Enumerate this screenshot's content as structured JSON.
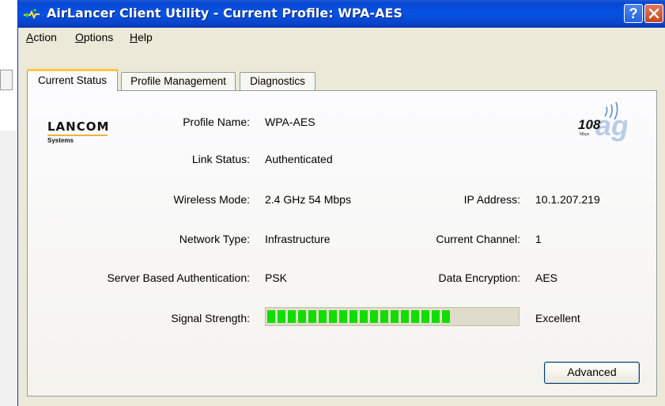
{
  "window": {
    "title": "AirLancer Client Utility - Current Profile: WPA-AES",
    "help_label": "?"
  },
  "menu": {
    "items": [
      {
        "label": "Action",
        "mnemonic": "A"
      },
      {
        "label": "Options",
        "mnemonic": "O"
      },
      {
        "label": "Help",
        "mnemonic": "H"
      }
    ]
  },
  "tabs": [
    {
      "label": "Current Status",
      "active": true
    },
    {
      "label": "Profile Management",
      "active": false
    },
    {
      "label": "Diagnostics",
      "active": false
    }
  ],
  "logo": {
    "name": "LANCOM",
    "sub": "Systems"
  },
  "badge": {
    "speed": "108",
    "unit": "Mbps",
    "band": "ag"
  },
  "status": {
    "profile_name_label": "Profile Name:",
    "profile_name": "WPA-AES",
    "link_status_label": "Link Status:",
    "link_status": "Authenticated",
    "wireless_mode_label": "Wireless Mode:",
    "wireless_mode": "2.4 GHz 54 Mbps",
    "ip_address_label": "IP Address:",
    "ip_address": "10.1.207.219",
    "network_type_label": "Network Type:",
    "network_type": "Infrastructure",
    "current_channel_label": "Current Channel:",
    "current_channel": "1",
    "server_auth_label": "Server Based Authentication:",
    "server_auth": "PSK",
    "data_encryption_label": "Data Encryption:",
    "data_encryption": "AES",
    "signal_strength_label": "Signal Strength:",
    "signal_strength": "Excellent",
    "signal_level": 0.86,
    "signal_segments": 18
  },
  "buttons": {
    "advanced": "Advanced"
  },
  "colors": {
    "titlebar": "#0553e4",
    "signal_green": "#10dd00",
    "tab_highlight": "#ffc83c"
  }
}
